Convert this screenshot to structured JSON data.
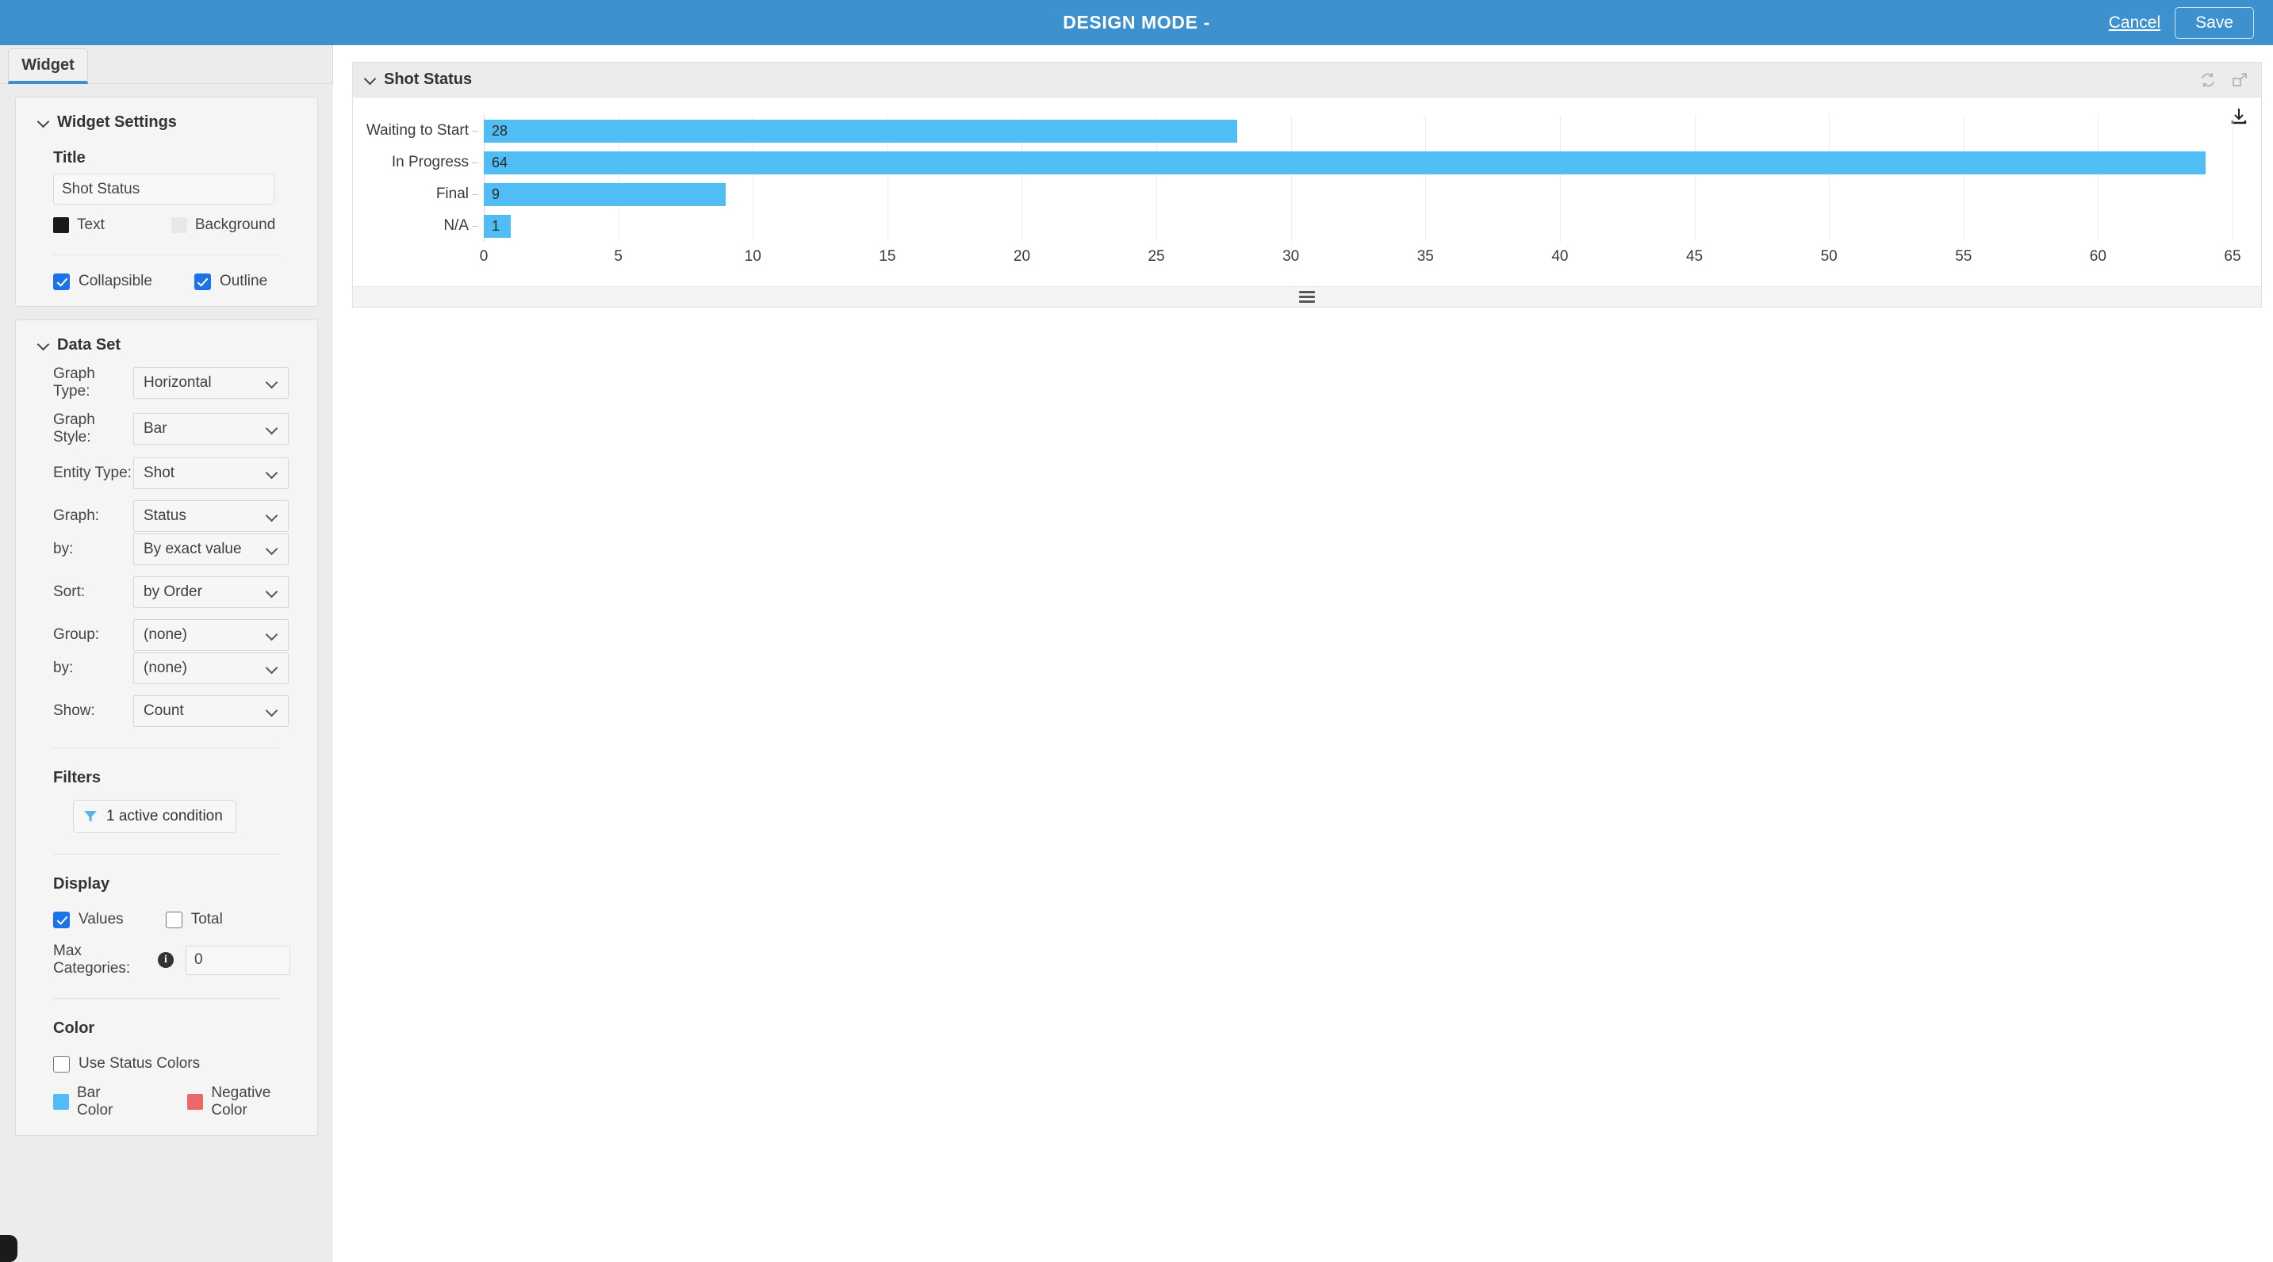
{
  "topbar": {
    "title": "DESIGN MODE -",
    "cancel_label": "Cancel",
    "save_label": "Save"
  },
  "tabs": [
    {
      "label": "Widget",
      "active": true
    }
  ],
  "widget_settings": {
    "section_title": "Widget Settings",
    "title_label": "Title",
    "title_value": "Shot Status",
    "title_placeholder": "Title",
    "text_color_label": "Text",
    "text_color": "#1a1a1a",
    "background_color_label": "Background",
    "background_color": "#e8e8e8",
    "collapsible_label": "Collapsible",
    "collapsible_checked": true,
    "outline_label": "Outline",
    "outline_checked": true
  },
  "data_set": {
    "section_title": "Data Set",
    "rows": [
      {
        "label": "Graph Type:",
        "value": "Horizontal"
      },
      {
        "label": "Graph Style:",
        "value": "Bar"
      },
      {
        "label": "Entity Type:",
        "value": "Shot"
      },
      {
        "label": "Graph:",
        "value": "Status"
      },
      {
        "label": "by:",
        "value": "By exact value"
      },
      {
        "label": "Sort:",
        "value": "by Order"
      },
      {
        "label": "Group:",
        "value": "(none)"
      },
      {
        "label": "by:",
        "value": "(none)"
      },
      {
        "label": "Show:",
        "value": "Count"
      }
    ]
  },
  "filters": {
    "section_title": "Filters",
    "button_label": "1 active condition",
    "icon_color": "#57b5e8"
  },
  "display": {
    "section_title": "Display",
    "values_label": "Values",
    "values_checked": true,
    "total_label": "Total",
    "total_checked": false,
    "max_categories_label": "Max Categories:",
    "max_categories_value": "0",
    "info_glyph": "i"
  },
  "color": {
    "section_title": "Color",
    "use_status_colors_label": "Use Status Colors",
    "use_status_colors_checked": false,
    "bar_color_label": "Bar Color",
    "bar_color": "#51bdf5",
    "negative_color_label": "Negative Color",
    "negative_color": "#ea6a6a"
  },
  "chart_panel": {
    "title": "Shot Status",
    "collapse_icon": "chevron-down-icon",
    "refresh_icon": "refresh-icon",
    "expand_icon": "expand-icon",
    "download_icon": "download-icon",
    "resize_handle_icon": "hamburger-icon"
  },
  "chart_data": {
    "type": "bar",
    "orientation": "horizontal",
    "title": "Shot Status",
    "categories": [
      "Waiting to Start",
      "In Progress",
      "Final",
      "N/A"
    ],
    "values": [
      28,
      64,
      9,
      1
    ],
    "value_labels": [
      "28",
      "64",
      "9",
      "1"
    ],
    "xlabel": "",
    "ylabel": "",
    "xlim": [
      0,
      65
    ],
    "xticks": [
      0,
      5,
      10,
      15,
      20,
      25,
      30,
      35,
      40,
      45,
      50,
      55,
      60,
      65
    ],
    "xtick_labels": [
      "0",
      "5",
      "10",
      "15",
      "20",
      "25",
      "30",
      "35",
      "40",
      "45",
      "50",
      "55",
      "60",
      "65"
    ],
    "grid": true,
    "legend": false,
    "bar_color": "#51bdf5",
    "show_values": true
  }
}
